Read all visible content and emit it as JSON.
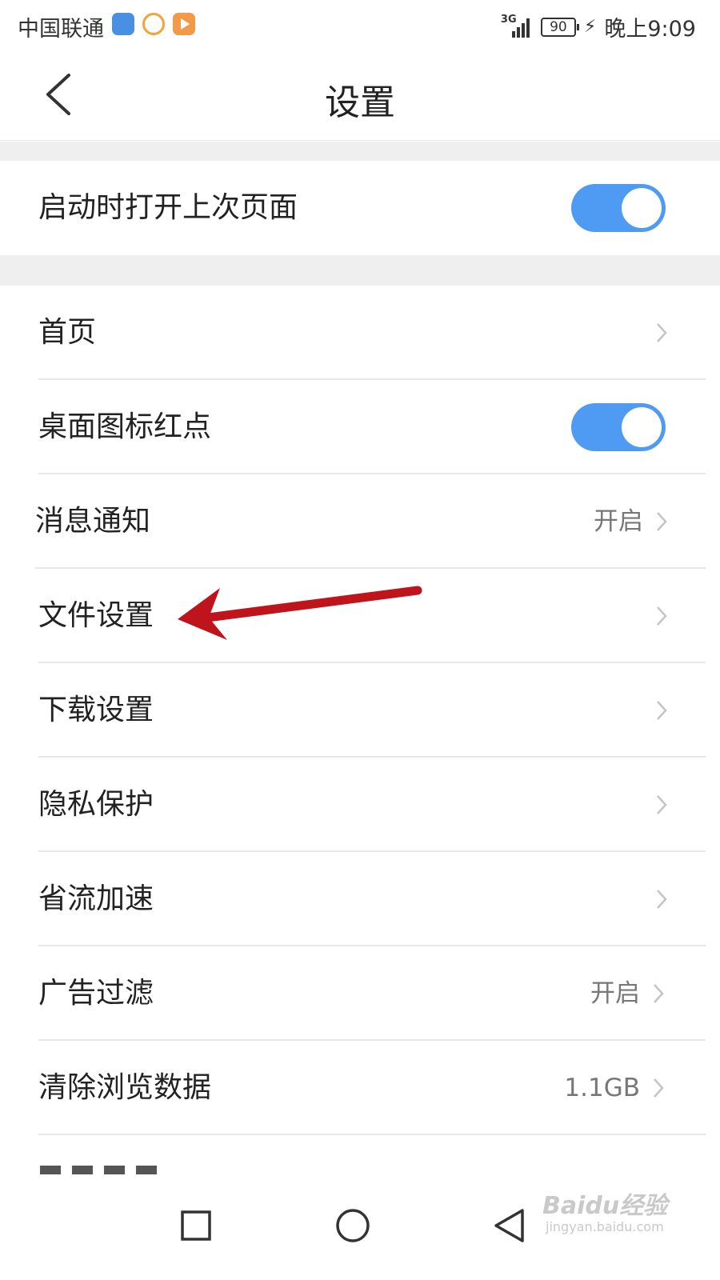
{
  "status_bar": {
    "carrier": "中国联通",
    "network": "3G",
    "battery": "90",
    "time": "晚上9:09"
  },
  "header": {
    "title": "设置",
    "back_icon": "chevron-left-icon"
  },
  "sections": {
    "startup": {
      "label": "启动时打开上次页面",
      "toggle_on": true
    },
    "items": [
      {
        "label": "首页",
        "value": ""
      },
      {
        "label": "桌面图标红点",
        "toggle_on": true
      },
      {
        "label": "消息通知",
        "value": "开启"
      },
      {
        "label": "文件设置",
        "value": ""
      },
      {
        "label": "下载设置",
        "value": ""
      },
      {
        "label": "隐私保护",
        "value": ""
      },
      {
        "label": "省流加速",
        "value": ""
      },
      {
        "label": "广告过滤",
        "value": "开启"
      },
      {
        "label": "清除浏览数据",
        "value": "1.1GB"
      }
    ]
  },
  "nav_bar": {
    "icons": [
      "recent-apps-icon",
      "home-icon",
      "back-icon"
    ]
  },
  "watermark": {
    "main": "Baidu经验",
    "sub": "jingyan.baidu.com"
  },
  "colors": {
    "toggle_accent": "#4f9af2",
    "annotation_arrow": "#c0141c",
    "page_background": "#efefef"
  }
}
